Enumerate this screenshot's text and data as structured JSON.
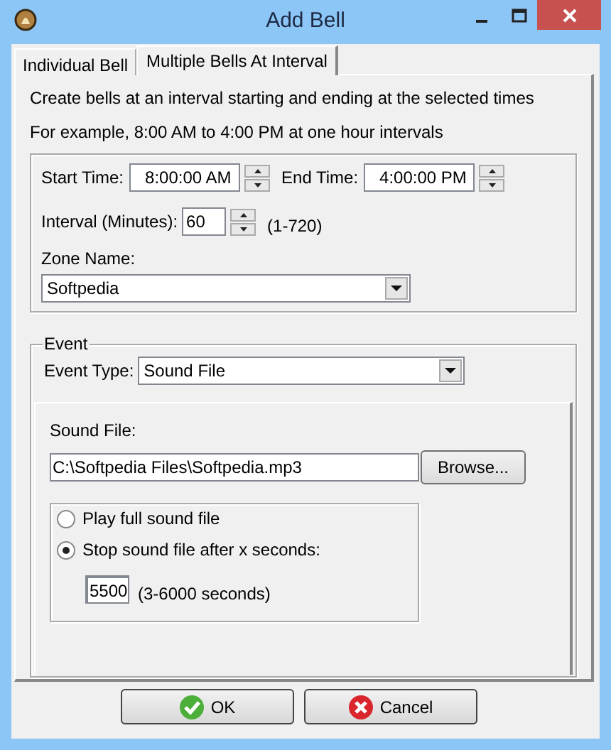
{
  "window": {
    "title": "Add Bell"
  },
  "tabs": [
    {
      "label": "Individual Bell",
      "selected": false
    },
    {
      "label": "Multiple Bells At Interval",
      "selected": true
    }
  ],
  "description": [
    "Create bells at an interval starting and ending at the selected times",
    "For example, 8:00 AM to 4:00 PM at one hour intervals"
  ],
  "start_time": {
    "label": "Start Time:",
    "value": "8:00:00 AM"
  },
  "end_time": {
    "label": "End Time:",
    "value": "4:00:00 PM"
  },
  "interval": {
    "label": "Interval (Minutes):",
    "value": "60",
    "range": "(1-720)"
  },
  "zone": {
    "label": "Zone Name:",
    "value": "Softpedia"
  },
  "event": {
    "title": "Event",
    "type_label": "Event Type:",
    "type_value": "Sound File",
    "sound_file": {
      "label": "Sound File:",
      "value": "C:\\Softpedia Files\\Softpedia.mp3",
      "browse": "Browse..."
    },
    "options": [
      {
        "label": "Play full sound file",
        "selected": false
      },
      {
        "label": "Stop sound file after x seconds:",
        "selected": true
      }
    ],
    "seconds": {
      "value": "5500",
      "range": "(3-6000 seconds)"
    }
  },
  "buttons": [
    {
      "label": "OK",
      "kind": "ok"
    },
    {
      "label": "Cancel",
      "kind": "cancel"
    }
  ]
}
